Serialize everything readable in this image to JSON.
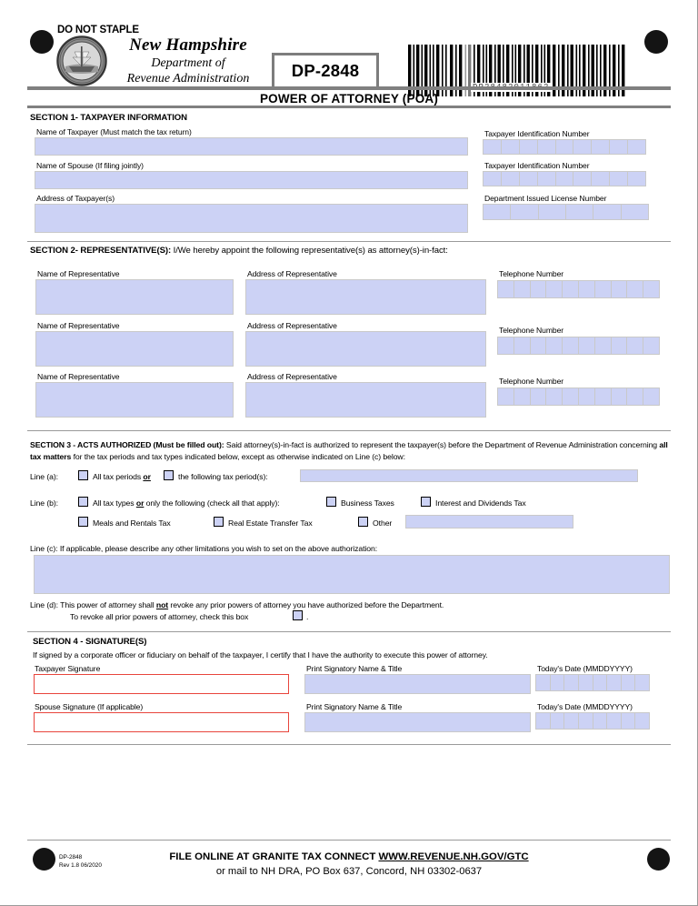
{
  "header": {
    "do_not_staple": "DO NOT STAPLE",
    "state_name": "New Hampshire",
    "dept_line1": "Department of",
    "dept_line2": "Revenue Administration",
    "form_number": "DP-2848",
    "barcode_text": "DP28482011862",
    "form_title": "POWER OF ATTORNEY (POA)",
    "seal_icon": "nh-state-seal-icon",
    "barcode_icon": "barcode-icon"
  },
  "section1": {
    "heading": "SECTION 1- TAXPAYER INFORMATION",
    "label_taxpayer_name": "Name of Taxpayer (Must match the tax return)",
    "label_spouse_name": "Name of Spouse (If filing jointly)",
    "label_address": "Address of Taxpayer(s)",
    "label_tin_1": "Taxpayer Identification Number",
    "label_tin_2": "Taxpayer Identification Number",
    "label_license": "Department Issued License Number",
    "taxpayer_name_value": "",
    "spouse_name_value": "",
    "address_value": "",
    "tin_cells": 9,
    "license_cells": 6
  },
  "section2": {
    "heading_bold": "SECTION 2- REPRESENTATIVE(S):",
    "heading_rest": "I/We hereby appoint the following representative(s) as attorney(s)-in-fact:",
    "label_name": "Name of Representative",
    "label_address": "Address of Representative",
    "label_phone": "Telephone Number",
    "phone_cells": 10,
    "rows": [
      {
        "name_value": "",
        "address_value": "",
        "phone_value": ""
      },
      {
        "name_value": "",
        "address_value": "",
        "phone_value": ""
      },
      {
        "name_value": "",
        "address_value": "",
        "phone_value": ""
      }
    ]
  },
  "section3": {
    "heading_bold": "SECTION 3 - ACTS AUTHORIZED (Must be filled out):",
    "body_part1": " Said attorney(s)-in-fact is authorized to represent the taxpayer(s) before the Department of Revenue Administration concerning ",
    "body_bold": "all tax matters",
    "body_part2": " for the tax periods and tax types indicated below, except as otherwise indicated on Line (c) below:",
    "line_a_label": "Line (a):",
    "line_a_opt1": "All tax periods",
    "line_a_or": "or",
    "line_a_opt2": "the following tax period(s):",
    "line_a_value": "",
    "line_b_label": "Line (b):",
    "line_b_opt1_pre": "All tax types ",
    "line_b_or": "or",
    "line_b_opt1_post": " only the following (check all that apply):",
    "line_b_business": "Business Taxes",
    "line_b_interest": "Interest and Dividends Tax",
    "line_b_meals": "Meals and Rentals Tax",
    "line_b_reet": "Real Estate Transfer Tax",
    "line_b_other": "Other",
    "line_b_other_value": "",
    "line_c_label": "Line (c):",
    "line_c_text": "If applicable, please describe any other limitations you wish to set on the above authorization:",
    "line_c_value": "",
    "line_d_label": "Line (d):",
    "line_d_text_pre": " This power of attorney shall ",
    "line_d_not": "not",
    "line_d_text_post": " revoke any prior powers of attorney you have authorized before the Department.",
    "line_d_revoke": "To revoke all prior powers of  attorney, check this box",
    "line_d_period": "."
  },
  "section4": {
    "heading": "SECTION 4 - SIGNATURE(S)",
    "certification": "If signed by a corporate officer or fiduciary on behalf of the taxpayer, I certify that I have the authority to execute this power of attorney.",
    "label_taxpayer_sig": "Taxpayer Signature",
    "label_spouse_sig": "Spouse Signature (If applicable)",
    "label_print_name_1": "Print Signatory Name & Title",
    "label_print_name_2": "Print Signatory Name & Title",
    "label_date_1": "Today's Date (MMDDYYYY)",
    "label_date_2": "Today's Date (MMDDYYYY)",
    "date_cells": 8,
    "taxpayer_sig_value": "",
    "spouse_sig_value": "",
    "print_name_1_value": "",
    "print_name_2_value": ""
  },
  "footer": {
    "form_id": "DP-2848",
    "revision": "Rev 1.8  06/2020",
    "file_online_pre": "FILE ONLINE AT GRANITE TAX CONNECT ",
    "file_online_url": "WWW.REVENUE.NH.GOV/GTC",
    "mail_to": "or mail to NH DRA, PO Box 637, Concord, NH 03302-0637"
  },
  "colors": {
    "field_fill": "#ccd2f5",
    "field_border": "#c9c9c9",
    "signature_border": "#e8453c",
    "rule": "#808080",
    "page_bg": "#b4b4b4"
  }
}
